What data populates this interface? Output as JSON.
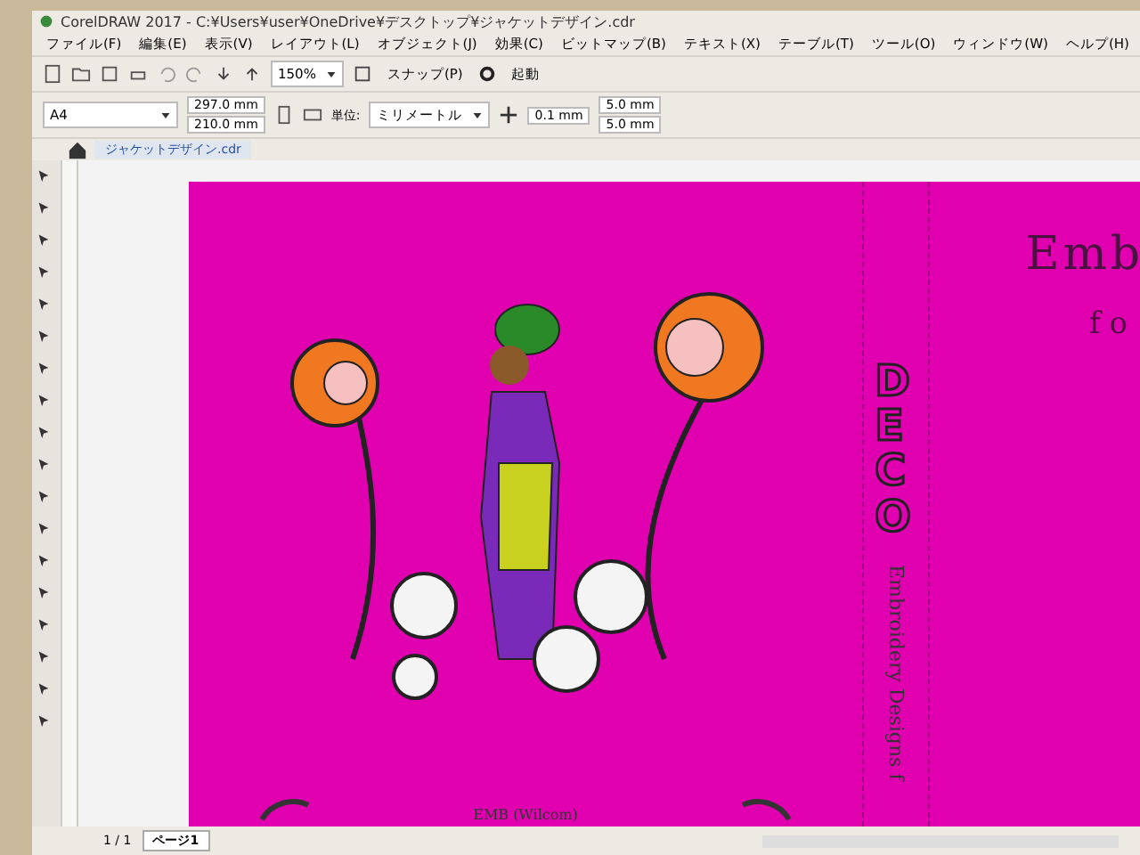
{
  "window": {
    "title": "CorelDRAW 2017 - C:¥Users¥user¥OneDrive¥デスクトップ¥ジャケットデザイン.cdr"
  },
  "menu": [
    "ファイル(F)",
    "編集(E)",
    "表示(V)",
    "レイアウト(L)",
    "オブジェクト(J)",
    "効果(C)",
    "ビットマップ(B)",
    "テキスト(X)",
    "テーブル(T)",
    "ツール(O)",
    "ウィンドウ(W)",
    "ヘルプ(H)"
  ],
  "toolbar": {
    "zoom": "150%",
    "snap": "スナップ(P)",
    "launch": "起動"
  },
  "property_bar": {
    "paper": "A4",
    "width": "297.0 mm",
    "height": "210.0 mm",
    "unit_label": "単位:",
    "unit": "ミリメートル",
    "nudge": "0.1 mm",
    "duplicate_x": "5.0 mm",
    "duplicate_y": "5.0 mm"
  },
  "document_tabs": [
    {
      "label": "ジャケットデザイン.cdr",
      "selected": true
    }
  ],
  "canvas": {
    "title": "Emb",
    "subtitle": "fo",
    "spine_logo": "DECO",
    "spine_text": "Embroidery Designs f",
    "footer": "EMB (Wilcom)"
  },
  "page_nav": {
    "pages": "1 / 1",
    "page_tabs": [
      {
        "label": "ページ1",
        "selected": true
      }
    ]
  }
}
